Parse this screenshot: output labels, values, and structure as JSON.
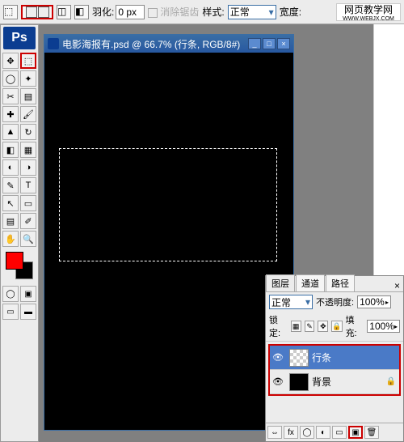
{
  "options": {
    "feather_label": "羽化:",
    "feather_value": "0 px",
    "antialias_label": "消除锯齿",
    "style_label": "样式:",
    "style_value": "正常",
    "width_label": "宽度:"
  },
  "watermark": {
    "line1": "网页教学网",
    "line2": "WWW.WEBJX.COM"
  },
  "toolbox": {
    "logo": "Ps"
  },
  "document": {
    "title": "电影海报有.psd @ 66.7% (行条, RGB/8#)"
  },
  "layers_panel": {
    "tabs": {
      "layers": "图层",
      "channels": "通道",
      "paths": "路径"
    },
    "close": "×",
    "blend_mode": "正常",
    "opacity_label": "不透明度:",
    "opacity_value": "100%",
    "lock_label": "锁定:",
    "fill_label": "填充:",
    "fill_value": "100%",
    "layers": [
      {
        "name": "行条",
        "selected": true,
        "thumb": "trans"
      },
      {
        "name": "背景",
        "selected": false,
        "thumb": "black",
        "locked": true
      }
    ],
    "footer": {
      "link": "⇔",
      "fx": "fx",
      "mask": "◯",
      "adj": "◐",
      "group": "▭",
      "new": "▣",
      "trash": "🗑"
    }
  }
}
